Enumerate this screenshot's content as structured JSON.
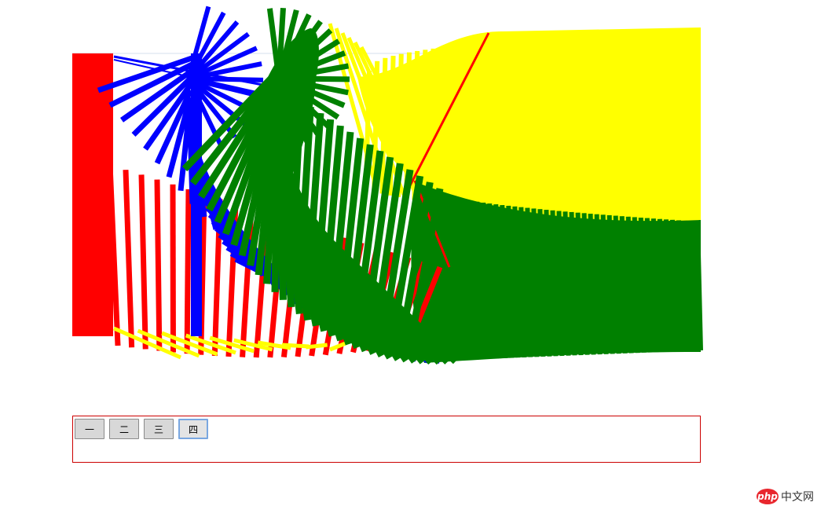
{
  "tabs": [
    {
      "label": "一",
      "active": false
    },
    {
      "label": "二",
      "active": false
    },
    {
      "label": "三",
      "active": false
    },
    {
      "label": "四",
      "active": true
    }
  ],
  "colors": {
    "red": "#ff0000",
    "blue": "#0000ff",
    "green": "#008000",
    "yellow": "#ffff00",
    "panel_border": "#cc0000",
    "guide_line": "#c8d4e8"
  },
  "watermark": {
    "logo": "php",
    "text": "中文网"
  }
}
